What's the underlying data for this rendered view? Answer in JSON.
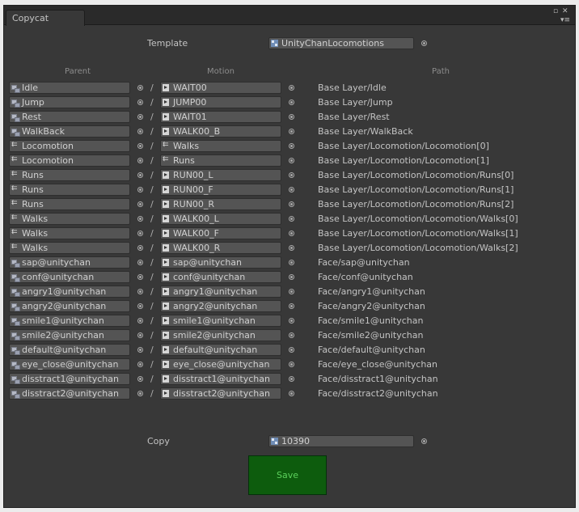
{
  "window": {
    "tab_title": "Copycat",
    "maximize_icon": "maximize-icon",
    "close_icon": "close-icon",
    "menu_icon": "context-menu-icon"
  },
  "template": {
    "label": "Template",
    "value": "UnityChanLocomotions",
    "icon": "asset-icon"
  },
  "headers": {
    "parent": "Parent",
    "motion": "Motion",
    "path": "Path"
  },
  "separator": "/",
  "rows": [
    {
      "parent": "Idle",
      "parent_icon": "go",
      "motion": "WAIT00",
      "motion_icon": "anim",
      "path": "Base Layer/Idle"
    },
    {
      "parent": "Jump",
      "parent_icon": "go",
      "motion": "JUMP00",
      "motion_icon": "anim",
      "path": "Base Layer/Jump"
    },
    {
      "parent": "Rest",
      "parent_icon": "go",
      "motion": "WAIT01",
      "motion_icon": "anim",
      "path": "Base Layer/Rest"
    },
    {
      "parent": "WalkBack",
      "parent_icon": "go",
      "motion": "WALK00_B",
      "motion_icon": "anim",
      "path": "Base Layer/WalkBack"
    },
    {
      "parent": "Locomotion",
      "parent_icon": "tree",
      "motion": "Walks",
      "motion_icon": "tree",
      "path": "Base Layer/Locomotion/Locomotion[0]"
    },
    {
      "parent": "Locomotion",
      "parent_icon": "tree",
      "motion": "Runs",
      "motion_icon": "tree",
      "path": "Base Layer/Locomotion/Locomotion[1]"
    },
    {
      "parent": "Runs",
      "parent_icon": "tree",
      "motion": "RUN00_L",
      "motion_icon": "anim",
      "path": "Base Layer/Locomotion/Locomotion/Runs[0]"
    },
    {
      "parent": "Runs",
      "parent_icon": "tree",
      "motion": "RUN00_F",
      "motion_icon": "anim",
      "path": "Base Layer/Locomotion/Locomotion/Runs[1]"
    },
    {
      "parent": "Runs",
      "parent_icon": "tree",
      "motion": "RUN00_R",
      "motion_icon": "anim",
      "path": "Base Layer/Locomotion/Locomotion/Runs[2]"
    },
    {
      "parent": "Walks",
      "parent_icon": "tree",
      "motion": "WALK00_L",
      "motion_icon": "anim",
      "path": "Base Layer/Locomotion/Locomotion/Walks[0]"
    },
    {
      "parent": "Walks",
      "parent_icon": "tree",
      "motion": "WALK00_F",
      "motion_icon": "anim",
      "path": "Base Layer/Locomotion/Locomotion/Walks[1]"
    },
    {
      "parent": "Walks",
      "parent_icon": "tree",
      "motion": "WALK00_R",
      "motion_icon": "anim",
      "path": "Base Layer/Locomotion/Locomotion/Walks[2]"
    },
    {
      "parent": "sap@unitychan",
      "parent_icon": "go",
      "motion": "sap@unitychan",
      "motion_icon": "anim",
      "path": "Face/sap@unitychan"
    },
    {
      "parent": "conf@unitychan",
      "parent_icon": "go",
      "motion": "conf@unitychan",
      "motion_icon": "anim",
      "path": "Face/conf@unitychan"
    },
    {
      "parent": "angry1@unitychan",
      "parent_icon": "go",
      "motion": "angry1@unitychan",
      "motion_icon": "anim",
      "path": "Face/angry1@unitychan"
    },
    {
      "parent": "angry2@unitychan",
      "parent_icon": "go",
      "motion": "angry2@unitychan",
      "motion_icon": "anim",
      "path": "Face/angry2@unitychan"
    },
    {
      "parent": "smile1@unitychan",
      "parent_icon": "go",
      "motion": "smile1@unitychan",
      "motion_icon": "anim",
      "path": "Face/smile1@unitychan"
    },
    {
      "parent": "smile2@unitychan",
      "parent_icon": "go",
      "motion": "smile2@unitychan",
      "motion_icon": "anim",
      "path": "Face/smile2@unitychan"
    },
    {
      "parent": "default@unitychan",
      "parent_icon": "go",
      "motion": "default@unitychan",
      "motion_icon": "anim",
      "path": "Face/default@unitychan"
    },
    {
      "parent": "eye_close@unitychan",
      "parent_icon": "go",
      "motion": "eye_close@unitychan",
      "motion_icon": "anim",
      "path": "Face/eye_close@unitychan"
    },
    {
      "parent": "disstract1@unitychan",
      "parent_icon": "go",
      "motion": "disstract1@unitychan",
      "motion_icon": "anim",
      "path": "Face/disstract1@unitychan"
    },
    {
      "parent": "disstract2@unitychan",
      "parent_icon": "go",
      "motion": "disstract2@unitychan",
      "motion_icon": "anim",
      "path": "Face/disstract2@unitychan"
    }
  ],
  "copy": {
    "label": "Copy",
    "value": "10390",
    "icon": "asset-icon"
  },
  "save": {
    "label": "Save",
    "color": "#0d5c0d",
    "text_color": "#5cd15c"
  }
}
